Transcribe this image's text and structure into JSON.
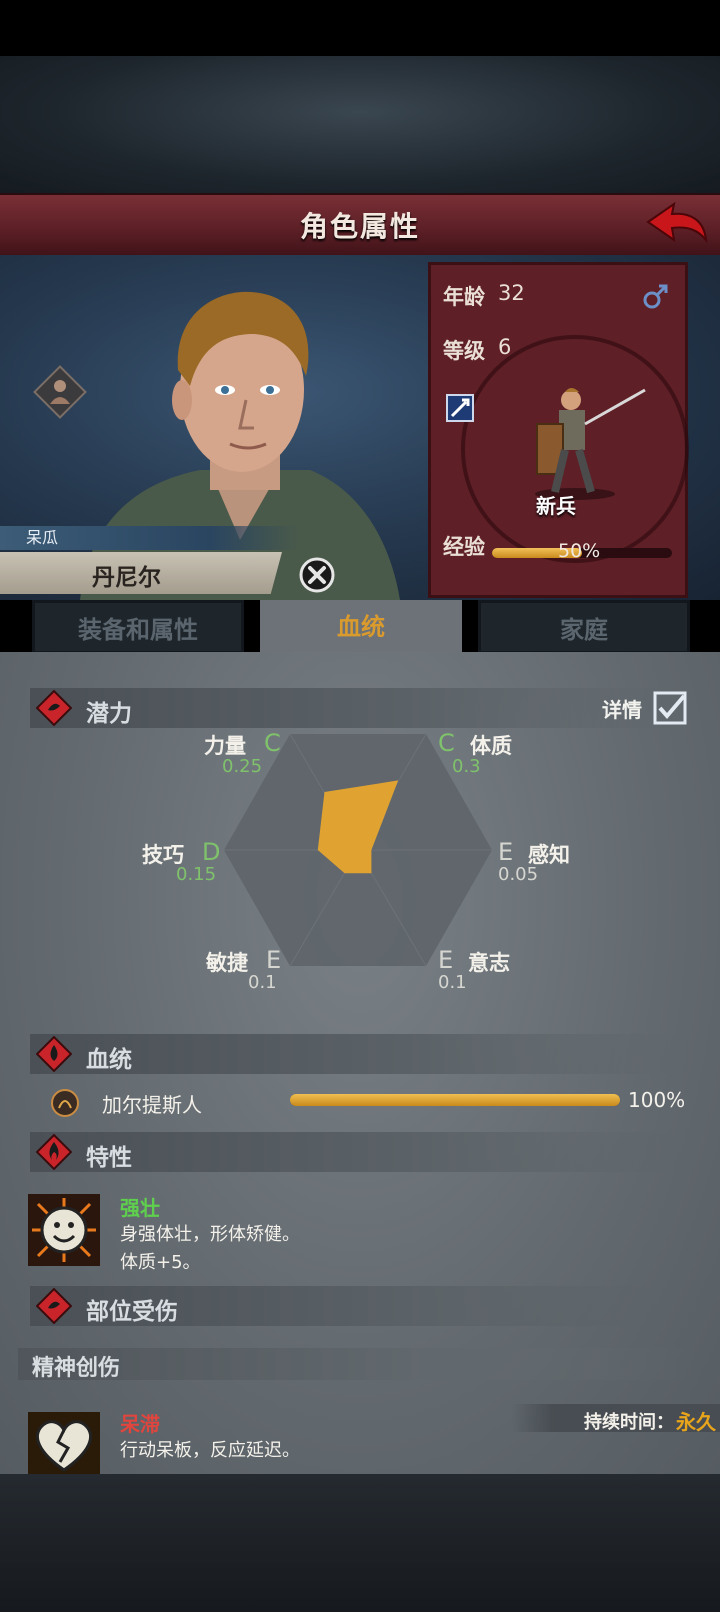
{
  "header": {
    "title": "角色属性"
  },
  "character": {
    "nickname": "呆瓜",
    "name": "丹尼尔",
    "age_label": "年龄",
    "age": "32",
    "level_label": "等级",
    "level": "6",
    "rank": "新兵",
    "exp_label": "经验",
    "exp_text": "50%",
    "exp_value": 0.5,
    "gender_icon": "male-icon"
  },
  "tabs": [
    {
      "label": "装备和属性",
      "active": false
    },
    {
      "label": "血统",
      "active": true
    },
    {
      "label": "家庭",
      "active": false
    }
  ],
  "potential": {
    "title": "潜力",
    "details_label": "详情",
    "details_checked": true,
    "stats": [
      {
        "name": "力量",
        "grade": "C",
        "value": "0.25",
        "v": 0.25
      },
      {
        "name": "体质",
        "grade": "C",
        "value": "0.3",
        "v": 0.3
      },
      {
        "name": "感知",
        "grade": "E",
        "value": "0.05",
        "v": 0.05
      },
      {
        "name": "意志",
        "grade": "E",
        "value": "0.1",
        "v": 0.1
      },
      {
        "name": "敏捷",
        "grade": "E",
        "value": "0.1",
        "v": 0.1
      },
      {
        "name": "技巧",
        "grade": "D",
        "value": "0.15",
        "v": 0.15
      }
    ]
  },
  "bloodline": {
    "title": "血统",
    "items": [
      {
        "name": "加尔提斯人",
        "percent": "100%",
        "value": 1.0
      }
    ]
  },
  "traits": {
    "title": "特性",
    "items": [
      {
        "name": "强壮",
        "desc1": "身强体壮，形体矫健。",
        "desc2": "体质+5。"
      }
    ]
  },
  "injuries": {
    "title": "部位受伤",
    "mental_title": "精神创伤",
    "items": [
      {
        "name": "呆滞",
        "desc1": "行动呆板，反应延迟。",
        "duration_label": "持续时间：",
        "duration": "永久"
      }
    ]
  },
  "colors": {
    "accent": "#d99a2e",
    "green_grade": "#7fc26b",
    "panel": "#5e1f27",
    "title_bar": "#6a2530",
    "trait_name": "#5fcf4e",
    "injury_name": "#e0453e"
  }
}
